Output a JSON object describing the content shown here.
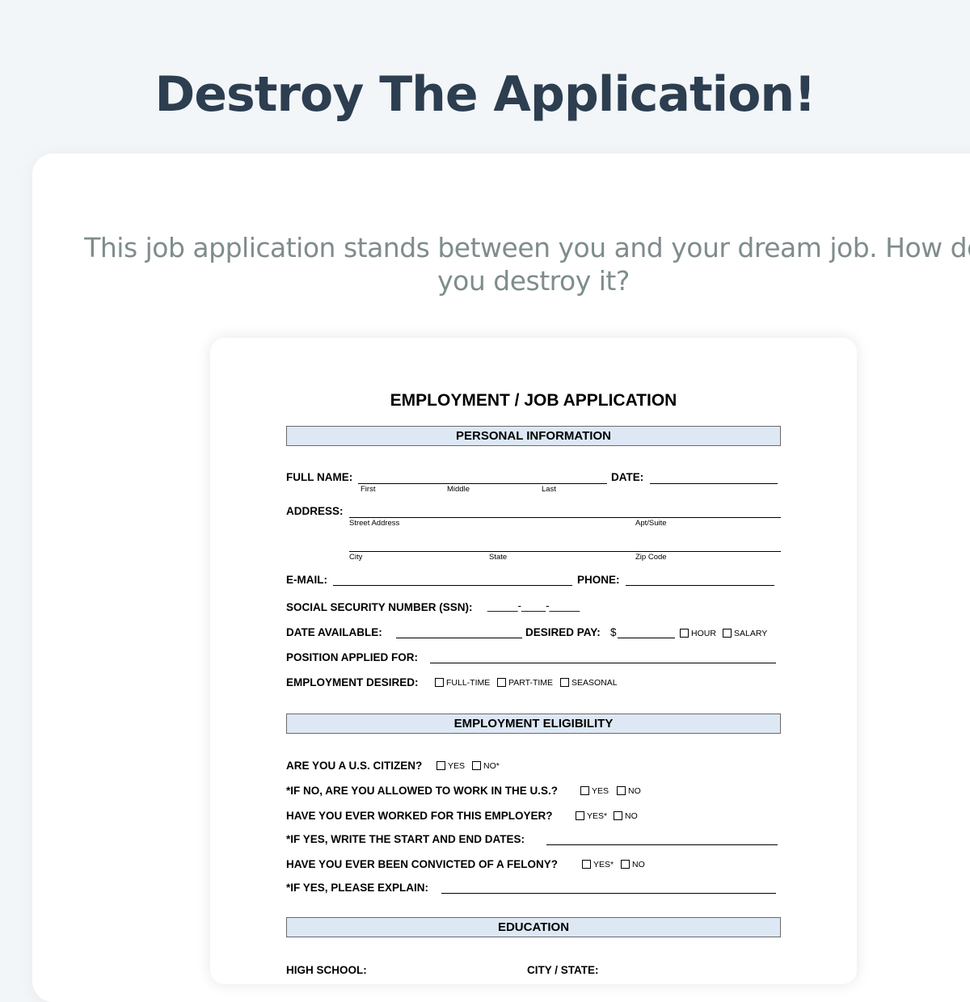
{
  "header": {
    "title": "Destroy The Application!"
  },
  "card": {
    "subtitle": "This job application stands between you and your dream job. How do you destroy it?"
  },
  "application": {
    "title": "EMPLOYMENT / JOB APPLICATION",
    "sections": {
      "personal": "PERSONAL INFORMATION",
      "eligibility": "EMPLOYMENT ELIGIBILITY",
      "education": "EDUCATION"
    },
    "personal": {
      "full_name": "FULL NAME:",
      "first": "First",
      "middle": "Middle",
      "last": "Last",
      "date": "DATE:",
      "address": "ADDRESS:",
      "street": "Street Address",
      "apt": "Apt/Suite",
      "city": "City",
      "state": "State",
      "zip": "Zip Code",
      "email": "E-MAIL:",
      "phone": "PHONE:",
      "ssn": "SOCIAL SECURITY NUMBER (SSN):",
      "ssn_blank": "_____-____-_____",
      "date_available": "DATE AVAILABLE:",
      "desired_pay": "DESIRED PAY:",
      "pay_prefix": "$",
      "hour": "HOUR",
      "salary": "SALARY",
      "position": "POSITION APPLIED FOR:",
      "employment_desired": "EMPLOYMENT DESIRED:",
      "full_time": "FULL-TIME",
      "part_time": "PART-TIME",
      "seasonal": "SEASONAL"
    },
    "eligibility": {
      "q1": "ARE YOU A U.S. CITIZEN?",
      "q1_yes": "YES",
      "q1_no": "NO*",
      "q2": "*IF NO, ARE YOU ALLOWED TO WORK IN THE U.S.?",
      "q2_yes": "YES",
      "q2_no": "NO",
      "q3": "HAVE YOU EVER WORKED FOR THIS EMPLOYER?",
      "q3_yes": "YES*",
      "q3_no": "NO",
      "q4": "*IF YES, WRITE THE START AND END DATES:",
      "q5": "HAVE YOU EVER BEEN CONVICTED OF A FELONY?",
      "q5_yes": "YES*",
      "q5_no": "NO",
      "q6": "*IF YES, PLEASE EXPLAIN:"
    },
    "education": {
      "high_school": "HIGH SCHOOL:",
      "city_state": "CITY / STATE:"
    }
  }
}
